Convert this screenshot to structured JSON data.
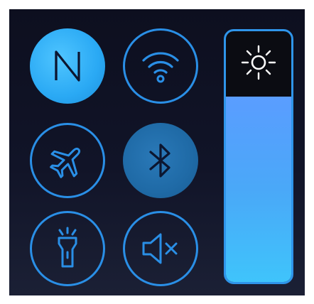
{
  "quick_settings": {
    "tiles": [
      {
        "id": "nfc",
        "icon": "nfc-icon",
        "active": true
      },
      {
        "id": "wifi",
        "icon": "wifi-icon",
        "active": false
      },
      {
        "id": "airplane",
        "icon": "airplane-icon",
        "active": false
      },
      {
        "id": "bluetooth",
        "icon": "bluetooth-icon",
        "active": true
      },
      {
        "id": "flashlight",
        "icon": "flashlight-icon",
        "active": false
      },
      {
        "id": "mute",
        "icon": "speaker-mute-icon",
        "active": false
      }
    ],
    "brightness": {
      "icon": "sun-icon",
      "level": 0.74
    }
  },
  "colors": {
    "accent": "#2a8fe6",
    "active_fill": "#2aa9f4",
    "bluetooth_fill": "#1f6aa6",
    "background": "#0f1122",
    "slider_top": "#5a9dff",
    "slider_bottom": "#3fc4fb"
  }
}
